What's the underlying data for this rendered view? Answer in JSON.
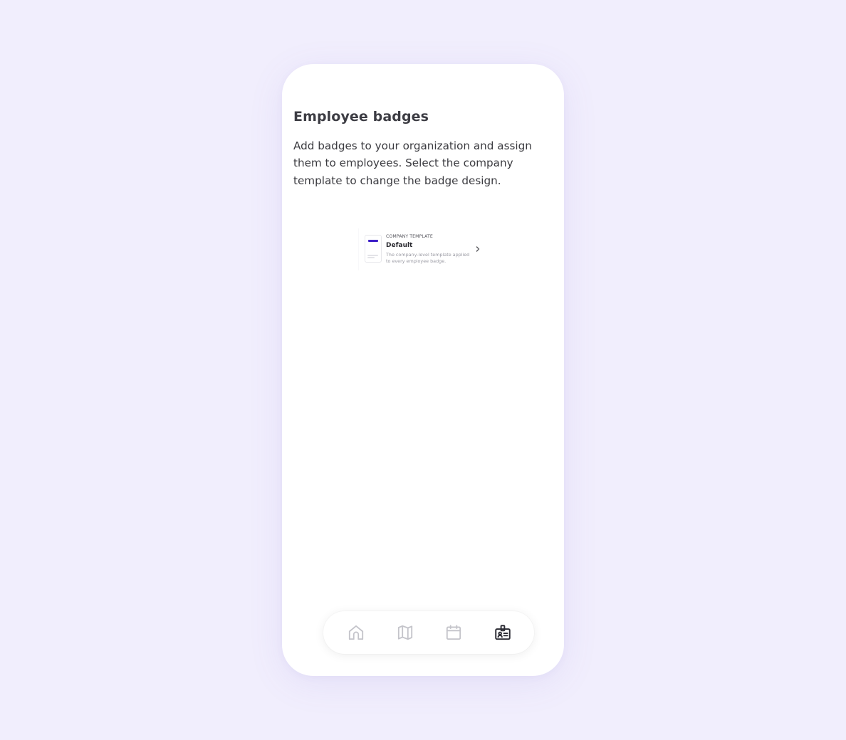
{
  "page": {
    "title": "Employee badges",
    "description": "Add badges to your organization and assign them to employees. Select the company template to change the badge design."
  },
  "template_card": {
    "eyebrow": "COMPANY TEMPLATE",
    "name": "Default",
    "description": "The company-level template applied to every employee badge.",
    "accent_color": "#3d1fc7",
    "chevron_icon": "chevron-right-icon"
  },
  "bottom_nav": {
    "items": [
      {
        "icon": "home-icon",
        "active": false
      },
      {
        "icon": "map-icon",
        "active": false
      },
      {
        "icon": "calendar-icon",
        "active": false
      },
      {
        "icon": "id-badge-icon",
        "active": true
      }
    ],
    "active_color": "#2b2b33",
    "inactive_color": "#c4c4ca"
  },
  "colors": {
    "background": "#f1eefd",
    "surface": "#ffffff",
    "text_primary": "#3c3c43"
  }
}
